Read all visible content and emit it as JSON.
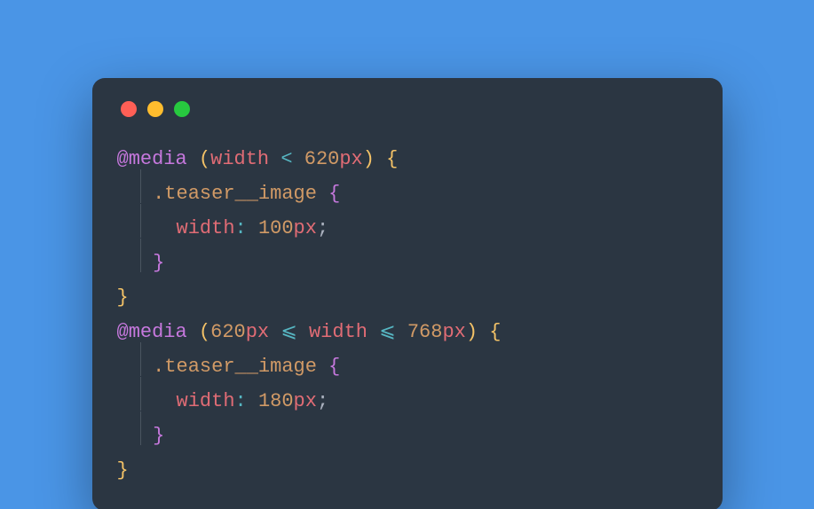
{
  "window": {
    "traffic": {
      "close": "close",
      "min": "minimize",
      "max": "maximize"
    }
  },
  "code": {
    "media_kw": "@media",
    "block1": {
      "selector": ".teaser__image",
      "prop": "width",
      "value_num": "100",
      "value_unit": "px",
      "query": {
        "lhs": "width",
        "op": "<",
        "rhs_num": "620",
        "rhs_unit": "px"
      }
    },
    "block2": {
      "selector": ".teaser__image",
      "prop": "width",
      "value_num": "180",
      "value_unit": "px",
      "query": {
        "lhs_num": "620",
        "lhs_unit": "px",
        "op1": "⩽",
        "mid": "width",
        "op2": "⩽",
        "rhs_num": "768",
        "rhs_unit": "px"
      }
    }
  }
}
